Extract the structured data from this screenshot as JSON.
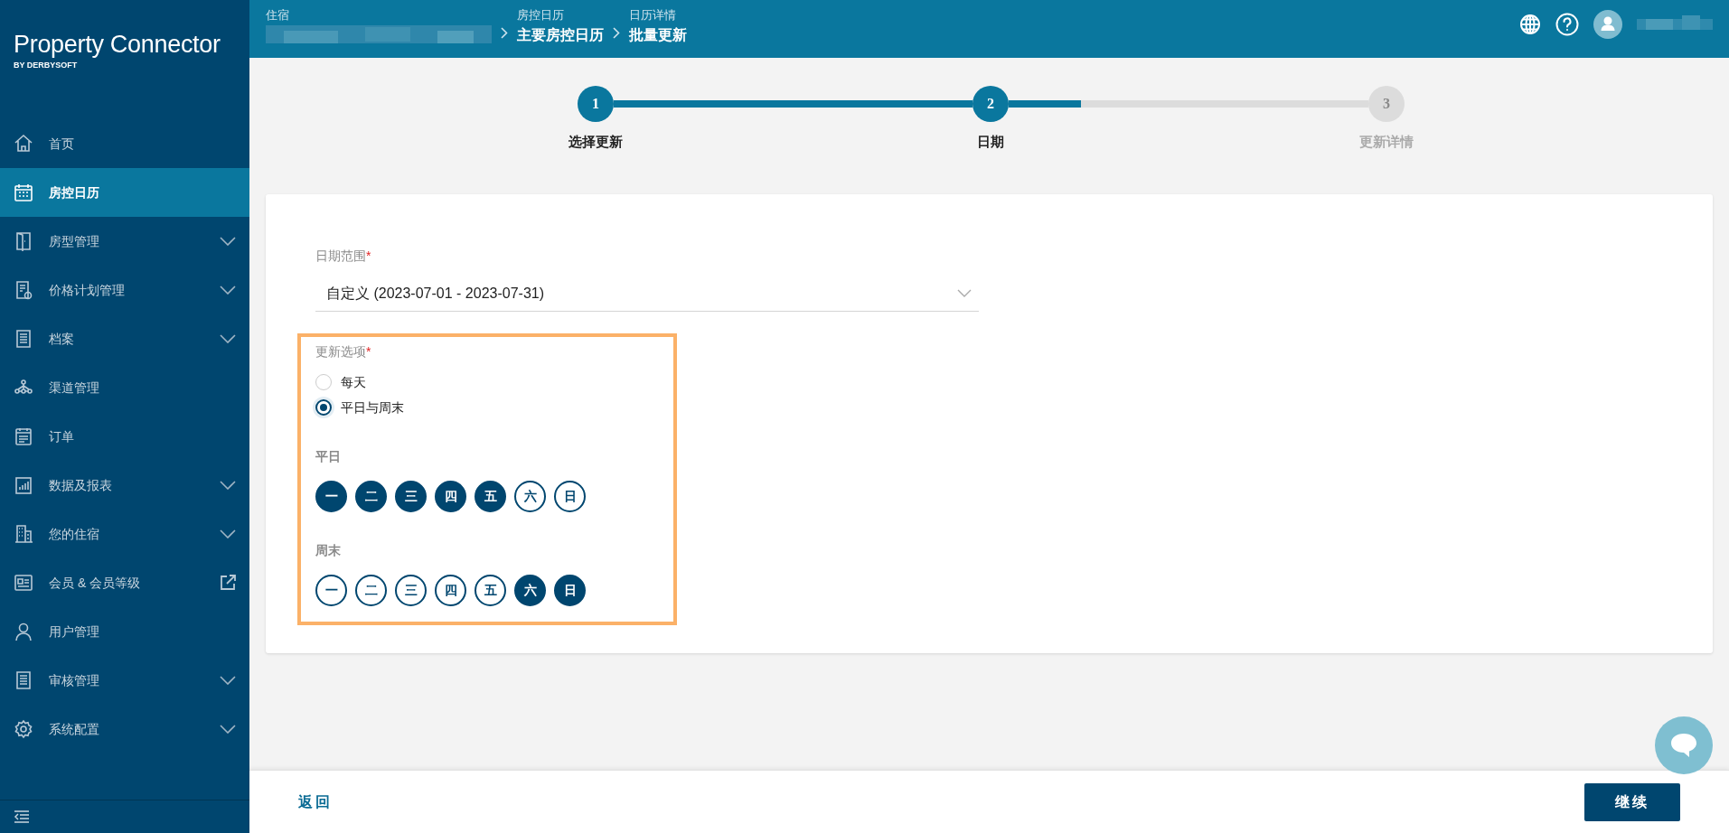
{
  "app": {
    "logo": "Property Connector",
    "logo_subtitle": "BY DERBYSOFT"
  },
  "header": {
    "breadcrumbs": [
      {
        "label": "住宿"
      },
      {
        "label": "房控日历",
        "value": "主要房控日历"
      },
      {
        "label": "日历详情",
        "value": "批量更新"
      }
    ]
  },
  "sidebar": {
    "items": [
      {
        "label": "首页",
        "kind": "link",
        "selected": false
      },
      {
        "label": "房控日历",
        "kind": "link",
        "selected": true
      },
      {
        "label": "房型管理",
        "kind": "expandable",
        "selected": false
      },
      {
        "label": "价格计划管理",
        "kind": "expandable",
        "selected": false
      },
      {
        "label": "档案",
        "kind": "expandable",
        "selected": false
      },
      {
        "label": "渠道管理",
        "kind": "link",
        "selected": false
      },
      {
        "label": "订单",
        "kind": "link",
        "selected": false
      },
      {
        "label": "数据及报表",
        "kind": "expandable",
        "selected": false
      },
      {
        "label": "您的住宿",
        "kind": "expandable",
        "selected": false
      },
      {
        "label": "会员 & 会员等级",
        "kind": "external",
        "selected": false
      },
      {
        "label": "用户管理",
        "kind": "link",
        "selected": false
      },
      {
        "label": "审核管理",
        "kind": "expandable",
        "selected": false
      },
      {
        "label": "系统配置",
        "kind": "expandable",
        "selected": false
      }
    ]
  },
  "stepper": {
    "connectors": [
      {
        "level": 1
      },
      {
        "level": 0.2
      }
    ],
    "steps": [
      {
        "number": "1",
        "label": "选择更新",
        "reached": true
      },
      {
        "number": "2",
        "label": "日期",
        "reached": true
      },
      {
        "number": "3",
        "label": "更新详情",
        "reached": false
      }
    ]
  },
  "form": {
    "date_range": {
      "label": "日期范围",
      "required_mark": "*",
      "value": "自定义 (2023-07-01 - 2023-07-31)"
    },
    "update_options": {
      "label": "更新选项",
      "required_mark": "*",
      "highlighted": true,
      "options": [
        {
          "label": "每天",
          "selected": false
        },
        {
          "label": "平日与周末",
          "selected": true
        }
      ],
      "groups": [
        {
          "label": "平日",
          "days": [
            {
              "label": "一",
              "selected": true
            },
            {
              "label": "二",
              "selected": true
            },
            {
              "label": "三",
              "selected": true
            },
            {
              "label": "四",
              "selected": true
            },
            {
              "label": "五",
              "selected": true
            },
            {
              "label": "六",
              "selected": false
            },
            {
              "label": "日",
              "selected": false
            }
          ]
        },
        {
          "label": "周末",
          "days": [
            {
              "label": "一",
              "selected": false
            },
            {
              "label": "二",
              "selected": false
            },
            {
              "label": "三",
              "selected": false
            },
            {
              "label": "四",
              "selected": false
            },
            {
              "label": "五",
              "selected": false
            },
            {
              "label": "六",
              "selected": true
            },
            {
              "label": "日",
              "selected": true
            }
          ]
        }
      ]
    }
  },
  "footer": {
    "back": "返回",
    "continue": "继续"
  }
}
